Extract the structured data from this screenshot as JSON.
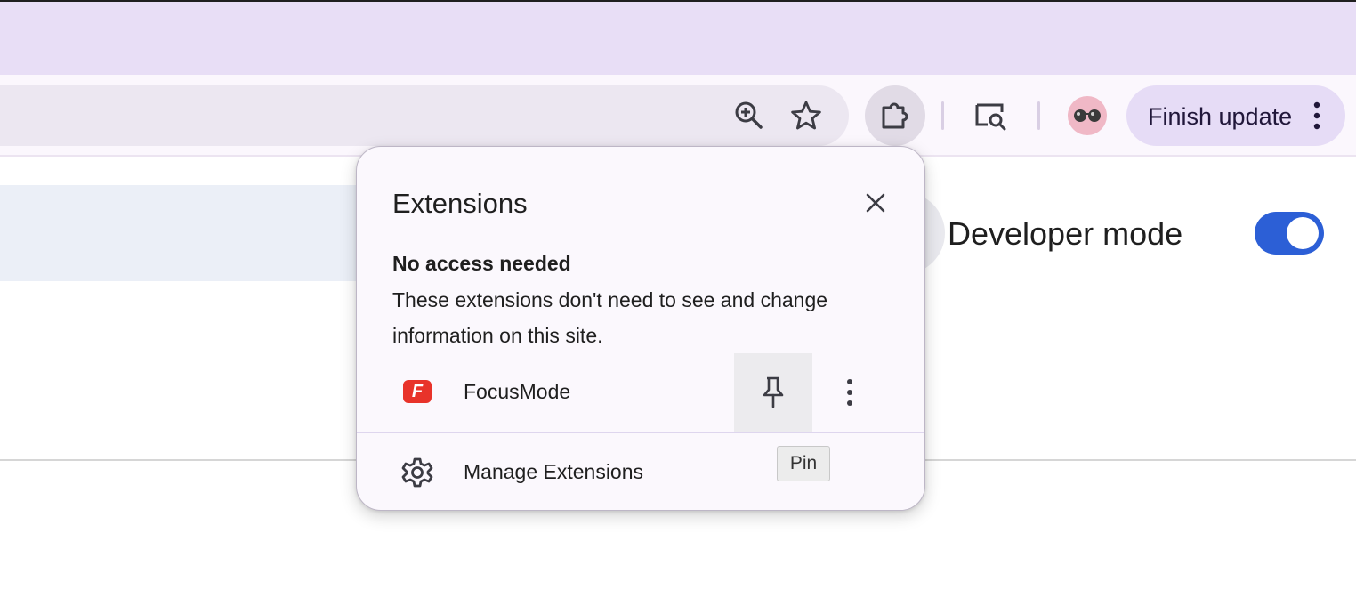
{
  "toolbar": {
    "icons": {
      "zoom": "zoom-in-icon",
      "bookmark": "star-icon",
      "extensions": "puzzle-icon",
      "page_search": "page-search-icon",
      "profile": "sunglasses-avatar-icon",
      "menu": "vertical-dots-icon"
    },
    "finish_update_label": "Finish update"
  },
  "page": {
    "developer_mode_label": "Developer mode",
    "developer_mode_on": true
  },
  "popup": {
    "title": "Extensions",
    "section_heading": "No access needed",
    "section_desc": "These extensions don't need to see and change information on this site.",
    "extensions": [
      {
        "name": "FocusMode",
        "logo_letter": "F",
        "logo_color": "#e8332a"
      }
    ],
    "manage_label": "Manage Extensions",
    "tooltip": "Pin"
  },
  "colors": {
    "tabstrip": "#e8def6",
    "toolbar": "#fbf7fd",
    "accent_toggle": "#2c5fd6",
    "finish_button": "#e6dcf6"
  }
}
